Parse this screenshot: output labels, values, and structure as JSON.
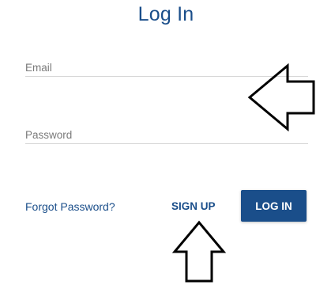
{
  "title": "Log In",
  "form": {
    "email_label": "Email",
    "password_label": "Password"
  },
  "actions": {
    "forgot_label": "Forgot Password?",
    "signup_label": "SIGN UP",
    "login_label": "LOG IN"
  },
  "annotations": {
    "left_arrow_icon": "left-arrow-outline",
    "up_arrow_icon": "up-arrow-outline"
  },
  "colors": {
    "accent": "#1a4e8a",
    "label": "#7a7a7a",
    "underline": "#d6d6d6",
    "background": "#ffffff"
  }
}
